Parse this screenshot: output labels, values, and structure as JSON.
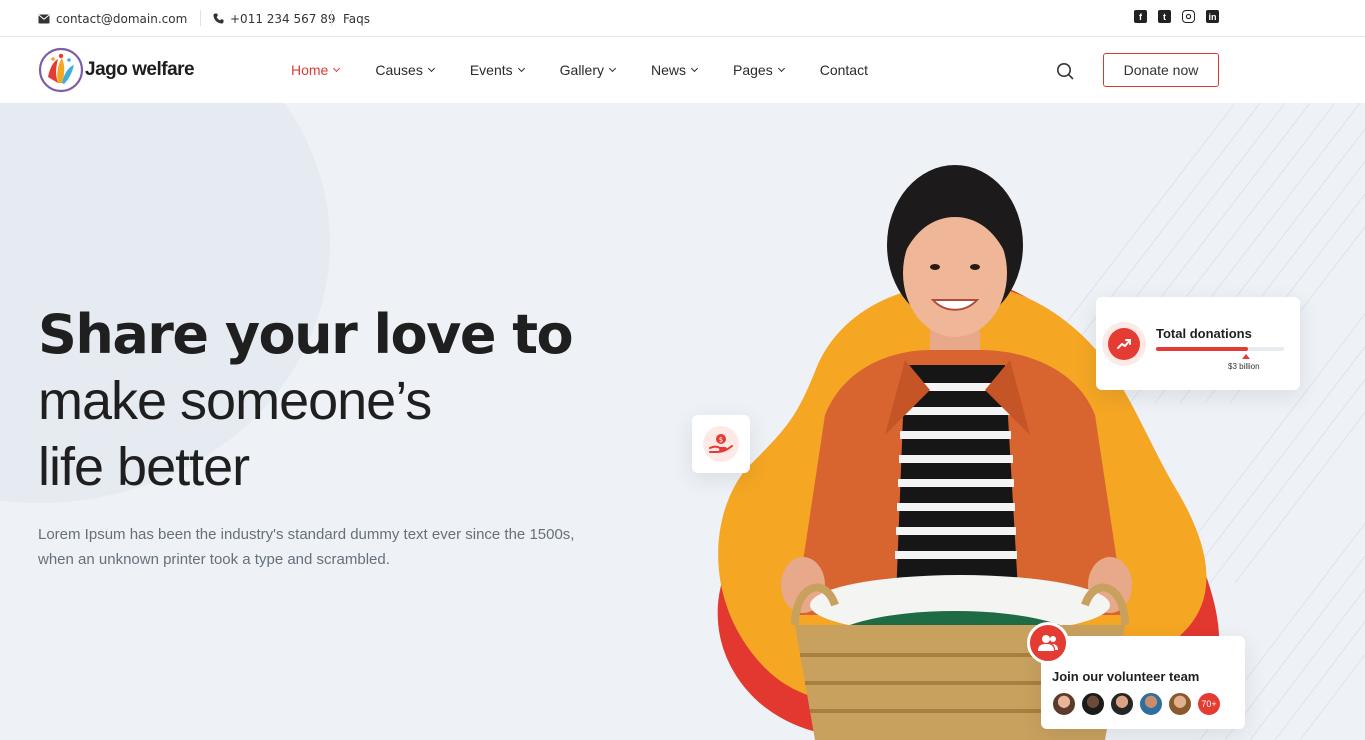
{
  "topbar": {
    "email": "contact@domain.com",
    "phone": "+011 234 567 89",
    "faqs": "Faqs",
    "socials": [
      "facebook-icon",
      "twitter-icon",
      "instagram-icon",
      "linkedin-icon"
    ]
  },
  "brand": {
    "name": "Jago welfare"
  },
  "nav": {
    "items": [
      {
        "label": "Home"
      },
      {
        "label": "Causes"
      },
      {
        "label": "Events"
      },
      {
        "label": "Gallery"
      },
      {
        "label": "News"
      },
      {
        "label": "Pages"
      },
      {
        "label": "Contact"
      }
    ],
    "donate_label": "Donate now"
  },
  "hero": {
    "highlight": "Share",
    "line1_rest": " your love to",
    "line2": "make someone’s",
    "line3": "life better",
    "description": "Lorem Ipsum has been the industry's standard dummy text ever since the 1500s, when an unknown printer took a type and scrambled."
  },
  "donation_card": {
    "title": "Total donations",
    "amount": "$3 billion",
    "progress": 0.72
  },
  "volunteer_card": {
    "title": "Join our volunteer team",
    "more": "70+"
  },
  "colors": {
    "accent": "#e43b33",
    "highlight": "#f6bd1f",
    "blob_yellow": "#f5a623",
    "blob_red": "#e2382f",
    "hero_bg": "#eef2f6"
  }
}
